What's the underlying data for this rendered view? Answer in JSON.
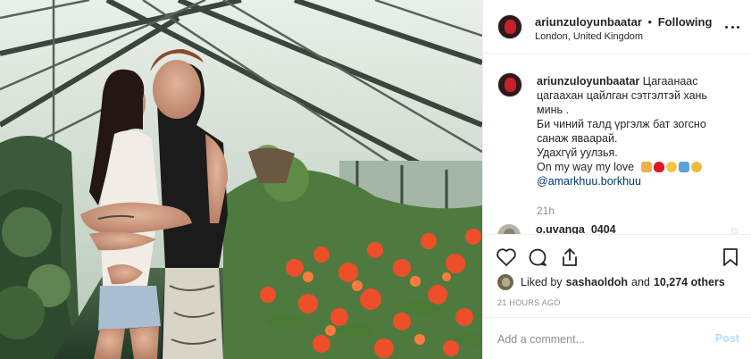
{
  "post": {
    "username": "ariunzuloyunbaatar",
    "separator": "•",
    "follow_status": "Following",
    "location": "London, United Kingdom"
  },
  "caption": {
    "username": "ariunzuloyunbaatar",
    "lines": [
      "Цагаанаас",
      "цагаахан цайлган сэтгэлтэй хань",
      "минь .",
      "Би чиний талд үргэлж бат зогсно",
      "санаж яваарай.",
      "Удахгүй уулзья.",
      "On my way my love"
    ],
    "mention": "@amarkhuu.borkhuu",
    "time": "21h",
    "emoji_icons": [
      "couple-emoji",
      "heart-emoji",
      "ok-hand-emoji",
      "airplane-emoji",
      "flexed-biceps-emoji"
    ]
  },
  "comment_preview": {
    "username": "o.uvanga_0404"
  },
  "actions": {
    "like_icon": "heart-outline-icon",
    "comment_icon": "comment-bubble-icon",
    "share_icon": "share-arrow-icon",
    "save_icon": "bookmark-icon"
  },
  "likes": {
    "prefix": "Liked by",
    "user": "sashaoldoh",
    "conjunction": "and",
    "others": "10,274 others"
  },
  "timestamp": "21 HOURS AGO",
  "comment_box": {
    "placeholder": "Add a comment...",
    "post_label": "Post"
  },
  "colors": {
    "link": "#003569",
    "post_disabled": "#b2dffc",
    "muted": "#8e8e8e",
    "text": "#262626"
  }
}
